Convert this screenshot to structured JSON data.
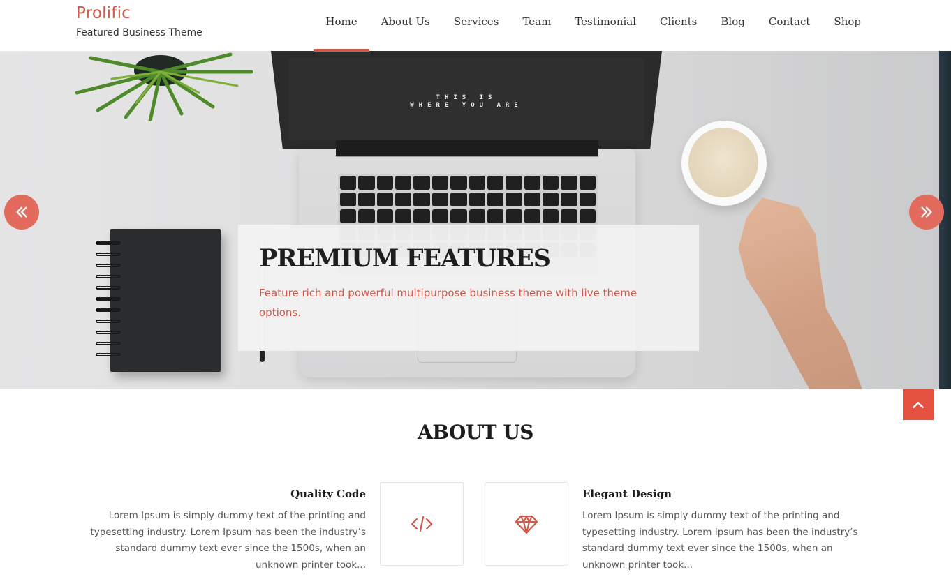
{
  "brand": {
    "title": "Prolific",
    "tagline": "Featured Business Theme"
  },
  "nav": {
    "items": [
      {
        "label": "Home",
        "active": true
      },
      {
        "label": "About Us",
        "active": false
      },
      {
        "label": "Services",
        "active": false
      },
      {
        "label": "Team",
        "active": false
      },
      {
        "label": "Testimonial",
        "active": false
      },
      {
        "label": "Clients",
        "active": false
      },
      {
        "label": "Blog",
        "active": false
      },
      {
        "label": "Contact",
        "active": false
      },
      {
        "label": "Shop",
        "active": false
      }
    ]
  },
  "hero": {
    "screen_line1": "THIS IS",
    "screen_line2": "WHERE YOU ARE",
    "caption_title": "PREMIUM FEATURES",
    "caption_text": "Feature rich and powerful multipurpose business theme with live theme options.",
    "prev_icon": "double-chevron-left-icon",
    "next_icon": "double-chevron-right-icon"
  },
  "back_to_top": {
    "icon": "chevron-up-icon"
  },
  "about": {
    "title": "ABOUT US",
    "features": [
      {
        "title": "Quality Code",
        "text": "Lorem Ipsum is simply dummy text of the printing and typesetting industry. Lorem Ipsum has been the industry’s standard dummy text ever since the 1500s, when an unknown printer took...",
        "icon": "code-icon"
      },
      {
        "title": "Elegant Design",
        "text": "Lorem Ipsum is simply dummy text of the printing and typesetting industry. Lorem Ipsum has been the industry’s standard dummy text ever since the 1500s, when an unknown printer took...",
        "icon": "diamond-icon"
      }
    ]
  },
  "colors": {
    "accent": "#d0584a",
    "arrow_bg": "#e26b5e",
    "back_to_top_bg": "#e4503e",
    "heading": "#1c1c1c",
    "body_text": "#555555"
  }
}
